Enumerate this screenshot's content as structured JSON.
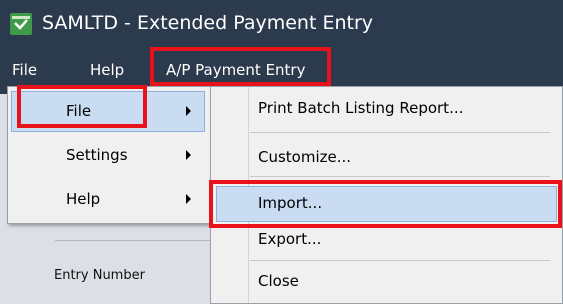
{
  "window": {
    "title": "SAMLTD - Extended Payment Entry",
    "icon": "app-check-icon"
  },
  "menubar": {
    "items": [
      "File",
      "Help",
      "A/P Payment Entry"
    ]
  },
  "left_menu": {
    "items": [
      {
        "label": "File",
        "submenu": true,
        "highlighted": true
      },
      {
        "label": "Settings",
        "submenu": true
      },
      {
        "label": "Help",
        "submenu": true
      }
    ]
  },
  "submenu": {
    "items": [
      "Print Batch Listing Report...",
      "Customize...",
      "Import...",
      "Export...",
      "Close"
    ]
  },
  "form": {
    "entry_number_label": "Entry Number"
  },
  "colors": {
    "titlebar": "#2b3a4d",
    "highlight_box": "#e8121b",
    "menu_bg": "#f0f0f0",
    "selection": "#c9dcf1"
  }
}
